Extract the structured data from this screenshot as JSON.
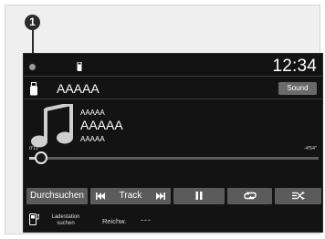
{
  "callout": {
    "number": "1"
  },
  "status_bar": {
    "clock": "12:34"
  },
  "source": {
    "title": "AAAAA",
    "sound_label": "Sound"
  },
  "track": {
    "artist": "AAAAA",
    "title": "AAAAA",
    "album": "AAAAA"
  },
  "progress": {
    "elapsed": "0'11\"",
    "total": "-4'54\"",
    "fraction": 0.04
  },
  "controls": {
    "search_label": "Durchsuchen",
    "track_label": "Track"
  },
  "bottom": {
    "ladestation": "Ladestation suchen",
    "range_label": "Reichw.",
    "range_value": "---"
  },
  "colors": {
    "screen_bg": "#131313",
    "button_bg": "#5b5b5b",
    "callout_bg": "#2b2b2b"
  }
}
